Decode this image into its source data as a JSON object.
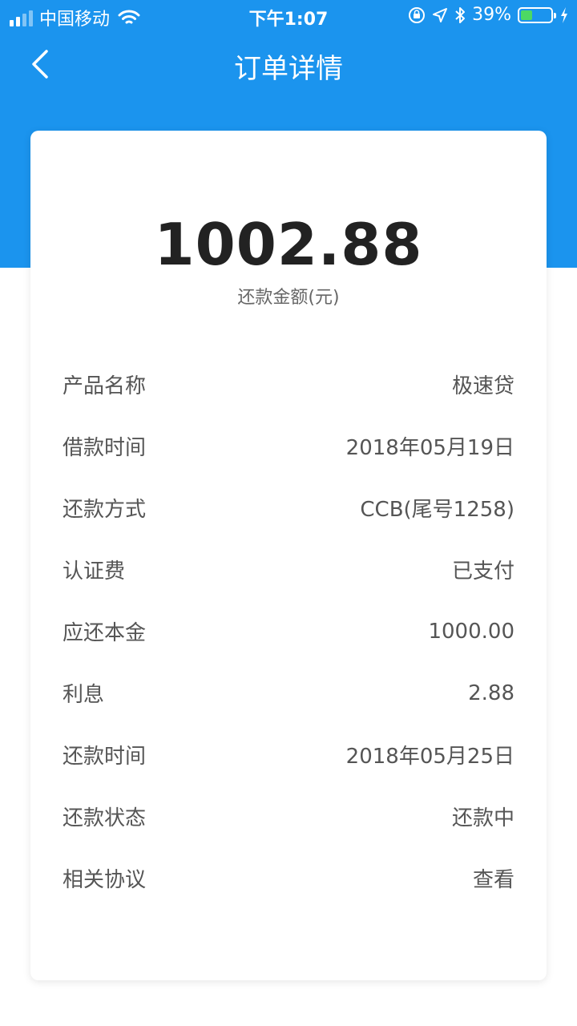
{
  "status_bar": {
    "carrier": "中国移动",
    "time": "下午1:07",
    "battery": "39%",
    "battery_level": 0.39
  },
  "nav": {
    "title": "订单详情"
  },
  "summary": {
    "amount": "1002.88",
    "amount_label": "还款金额(元)"
  },
  "rows": [
    {
      "label": "产品名称",
      "value": "极速贷"
    },
    {
      "label": "借款时间",
      "value": "2018年05月19日"
    },
    {
      "label": "还款方式",
      "value": "CCB(尾号1258)"
    },
    {
      "label": "认证费",
      "value": "已支付"
    },
    {
      "label": "应还本金",
      "value": "1000.00"
    },
    {
      "label": "利息",
      "value": "2.88"
    },
    {
      "label": "还款时间",
      "value": "2018年05月25日"
    },
    {
      "label": "还款状态",
      "value": "还款中"
    },
    {
      "label": "相关协议",
      "value": "查看"
    }
  ],
  "colors": {
    "header_blue": "#1b94ee",
    "battery_green": "#4cd964"
  }
}
